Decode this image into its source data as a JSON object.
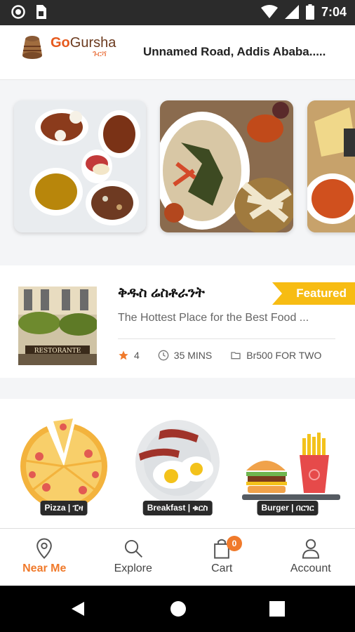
{
  "status_bar": {
    "time": "7:04",
    "icons": [
      "record-icon",
      "sim-card-icon",
      "wifi-icon",
      "signal-icon",
      "battery-icon"
    ]
  },
  "header": {
    "logo_go": "Go",
    "logo_gursha": "Gursha",
    "logo_amharic": "ጉርሻ",
    "address": "Unnamed Road, Addis Ababa....."
  },
  "restaurant": {
    "name": "ቅዱስ ሬስቶራንት",
    "description": "The Hottest Place for the Best Food ...",
    "badge": "Featured",
    "rating": "4",
    "time": "35 MINS",
    "price": "Br500 FOR TWO"
  },
  "categories": [
    {
      "label": "Pizza | ፒዛ"
    },
    {
      "label": "Breakfast | ቁርስ"
    },
    {
      "label": "Burger | በርገር"
    }
  ],
  "bottom_nav": {
    "items": [
      {
        "label": "Near Me",
        "icon": "location-pin-icon",
        "active": true
      },
      {
        "label": "Explore",
        "icon": "search-icon",
        "active": false
      },
      {
        "label": "Cart",
        "icon": "shopping-bag-icon",
        "active": false,
        "badge": "0"
      },
      {
        "label": "Account",
        "icon": "person-icon",
        "active": false
      }
    ]
  },
  "colors": {
    "accent": "#f07a2b",
    "featured": "#f7bc13",
    "status_bar": "#2b2b2b"
  }
}
